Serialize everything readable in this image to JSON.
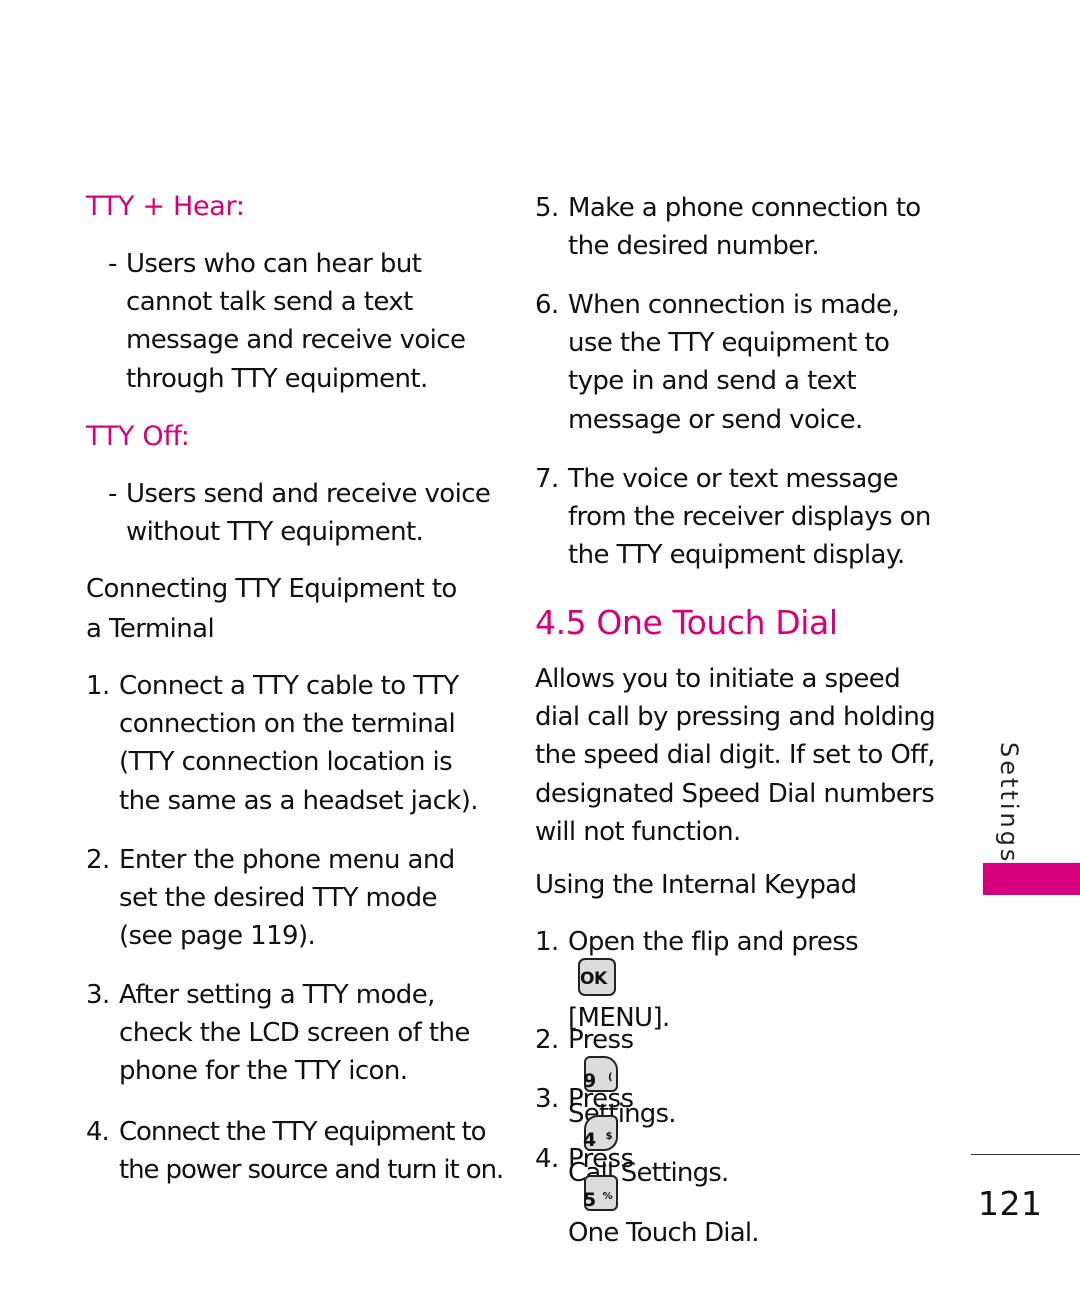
{
  "left_column": {
    "tty_hear": {
      "heading": "TTY + Hear:",
      "bullet": "-",
      "lines": [
        "Users who can hear but",
        "cannot talk send a text",
        "message and receive voice",
        "through TTY equipment."
      ]
    },
    "tty_off": {
      "heading": "TTY Off:",
      "bullet": "-",
      "lines": [
        "Users send and receive voice",
        "without TTY equipment."
      ]
    },
    "connecting": {
      "heading_lines": [
        "Connecting TTY Equipment to",
        "a Terminal"
      ],
      "steps": [
        {
          "num": "1.",
          "lines": [
            "Connect a TTY cable to TTY",
            "connection on the terminal",
            "(TTY connection location is",
            "the same as a headset jack)."
          ]
        },
        {
          "num": "2.",
          "lines": [
            "Enter the phone menu and",
            "set the desired TTY mode",
            "(see page 119)."
          ]
        },
        {
          "num": "3.",
          "lines": [
            "After setting a TTY mode,",
            "check the LCD screen of the",
            "phone for the TTY icon."
          ]
        },
        {
          "num": "4.",
          "lines": [
            "Connect the TTY equipment to",
            "the power source and turn it on."
          ]
        }
      ]
    }
  },
  "right_column": {
    "steps": [
      {
        "num": "5.",
        "lines": [
          "Make a phone connection to",
          "the desired number."
        ]
      },
      {
        "num": "6.",
        "lines": [
          "When connection is made,",
          "use the TTY equipment to",
          "type in and send a text",
          "message or send voice."
        ]
      },
      {
        "num": "7.",
        "lines": [
          "The voice or text message",
          "from the receiver displays on",
          "the TTY equipment display."
        ]
      }
    ],
    "one_touch_dial": {
      "title": "4.5 One Touch Dial",
      "description_lines": [
        "Allows you to initiate a speed",
        "dial call by pressing and holding",
        "the speed dial digit. If set to Off,",
        "designated Speed Dial numbers",
        "will not function."
      ],
      "keypad_heading": "Using the Internal Keypad",
      "keypad_steps": [
        {
          "num": "1.",
          "text": "Open the flip and press",
          "key": {
            "icon": "ok-key-icon",
            "label": "OK"
          },
          "continuation": "[MENU]."
        },
        {
          "num": "2.",
          "text": "Press",
          "key": {
            "icon": "key-9-icon",
            "digit": "9",
            "sup": "("
          },
          "target": "Settings."
        },
        {
          "num": "3.",
          "text": "Press",
          "key": {
            "icon": "key-4-icon",
            "digit": "4",
            "sup": "$"
          },
          "target": "Call Settings."
        },
        {
          "num": "4.",
          "text": "Press",
          "key": {
            "icon": "key-5-icon",
            "digit": "5",
            "sup": "%"
          },
          "target": "One Touch Dial."
        }
      ]
    }
  },
  "side_tab": {
    "label": "Settings",
    "color": "#d6007e"
  },
  "footer": {
    "page_number": "121"
  },
  "colors": {
    "accent": "#d6007e",
    "text": "#111111",
    "key_fill": "#dcdcdc"
  }
}
